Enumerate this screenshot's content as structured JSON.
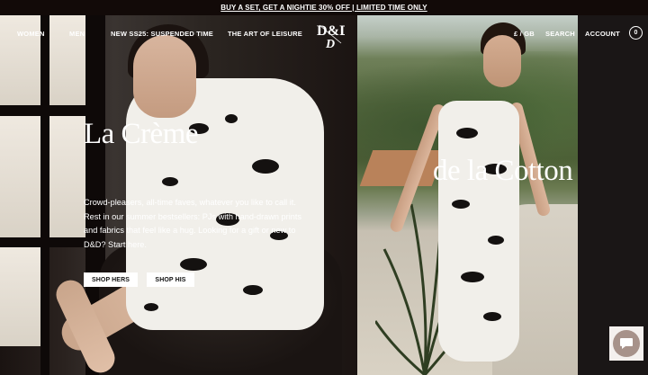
{
  "promo": {
    "text": "BUY A SET, GET A NIGHTIE 30% OFF | LIMITED TIME ONLY"
  },
  "nav": {
    "items": [
      "WOMEN",
      "MEN",
      "NEW SS25: SUSPENDED TIME",
      "THE ART OF LEISURE"
    ],
    "logo_text": "D&D",
    "currency": "£ / GB",
    "search": "SEARCH",
    "account": "ACCOUNT",
    "cart_count": "0"
  },
  "hero": {
    "title_left": "La Crème",
    "title_right": "de la Cotton",
    "body": "Crowd-pleasers, all-time faves, whatever you like to call it. Rest in our summer bestsellers: PJs with hand-drawn prints and fabrics that feel like a hug. Looking for a gift or new to D&D? Start here.",
    "cta_hers": "SHOP HERS",
    "cta_his": "SHOP HIS"
  },
  "icons": [
    "chat-icon"
  ],
  "colors": {
    "promo_bg": "#120a08",
    "chat_bg": "#a7928a"
  }
}
